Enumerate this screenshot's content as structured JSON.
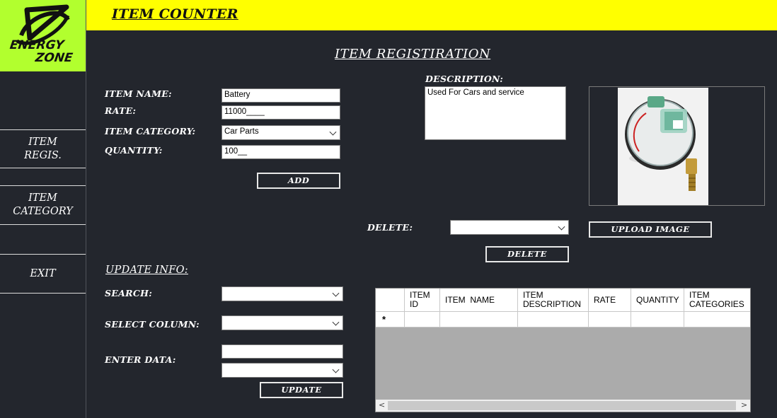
{
  "app": {
    "title": "ITEM COUNTER",
    "logo_text_line1": "ENERGY",
    "logo_text_line2": "ZONE",
    "colors": {
      "header": "#ffff00",
      "logo_bg": "#b2ff2e",
      "background": "#23262d"
    }
  },
  "sidebar": {
    "items": [
      {
        "label_line1": "ITEM",
        "label_line2": "REGIS."
      },
      {
        "label_line1": "ITEM",
        "label_line2": "CATEGORY"
      },
      {
        "label_line1": "EXIT",
        "label_line2": ""
      }
    ]
  },
  "registration": {
    "heading": "ITEM REGISTIRATION",
    "item_name_label": "ITEM NAME:",
    "item_name_value": "Battery",
    "rate_label": "RATE:",
    "rate_value": "11000____",
    "category_label": "ITEM CATEGORY:",
    "category_value": "Car Parts",
    "quantity_label": "QUANTITY:",
    "quantity_value": "100__",
    "add_button": "ADD",
    "description_label": "DESCRIPTION:",
    "description_value": "Used For Cars and service",
    "upload_button": "UPLOAD IMAGE",
    "delete_label": "DELETE:",
    "delete_value": "",
    "delete_button": "DELETE"
  },
  "update": {
    "heading": "UPDATE INFO:",
    "search_label": "SEARCH:",
    "search_value": "",
    "select_column_label": "SELECT COLUMN:",
    "select_column_value": "",
    "enter_data_label": "ENTER DATA:",
    "enter_data_value": "",
    "enter_data_select_value": "",
    "update_button": "UPDATE"
  },
  "grid": {
    "columns": [
      {
        "line1": "ITEM",
        "line2": "ID"
      },
      {
        "line1": "ITEM  NAME",
        "line2": ""
      },
      {
        "line1": "ITEM",
        "line2": "DESCRIPTION"
      },
      {
        "line1": "RATE",
        "line2": ""
      },
      {
        "line1": "QUANTITY",
        "line2": ""
      },
      {
        "line1": "ITEM",
        "line2": "CATEGORIES"
      }
    ],
    "new_row_marker": "*",
    "scroll_left": "<",
    "scroll_right": ">"
  }
}
